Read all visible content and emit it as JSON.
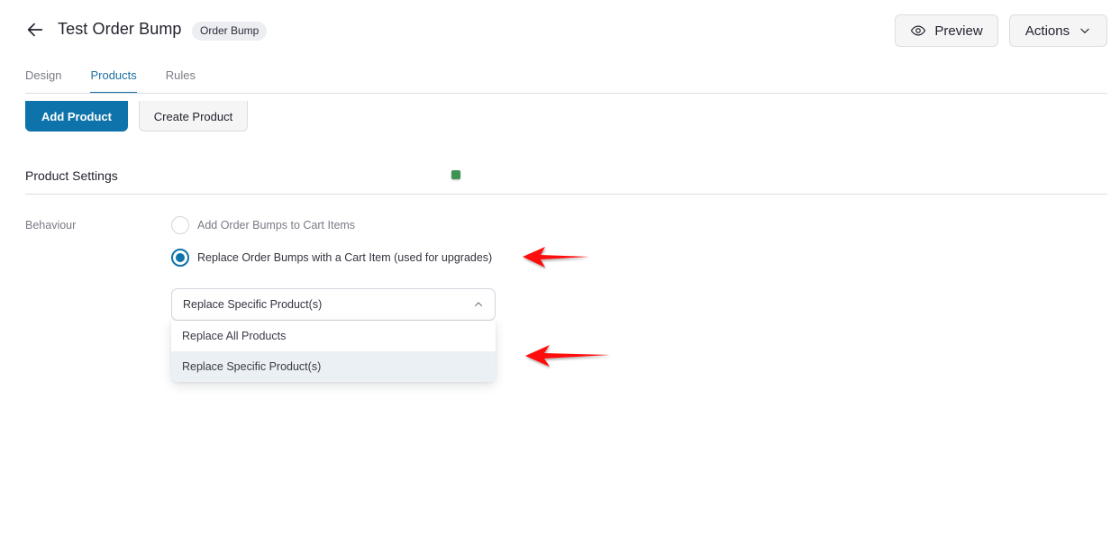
{
  "header": {
    "back_icon": "arrow-left-icon",
    "title": "Test Order Bump",
    "badge": "Order Bump",
    "preview_label": "Preview",
    "preview_icon": "eye-icon",
    "actions_label": "Actions",
    "actions_icon": "chevron-down-icon"
  },
  "tabs": [
    {
      "label": "Design",
      "active": false
    },
    {
      "label": "Products",
      "active": true
    },
    {
      "label": "Rules",
      "active": false
    }
  ],
  "product_buttons": {
    "add_label": "Add Product",
    "create_label": "Create Product"
  },
  "product_settings": {
    "title": "Product Settings",
    "behaviour_label": "Behaviour",
    "options": [
      {
        "label": "Add Order Bumps to Cart Items",
        "checked": false
      },
      {
        "label": "Replace Order Bumps with a Cart Item (used for upgrades)",
        "checked": true
      }
    ],
    "replace_select": {
      "value": "Replace Specific Product(s)",
      "expanded": true,
      "icon": "chevron-up-icon",
      "options": [
        {
          "label": "Replace All Products",
          "selected": false
        },
        {
          "label": "Replace Specific Product(s)",
          "selected": true
        }
      ]
    }
  },
  "annotations": {
    "arrow_color": "#ff0000",
    "arrows": [
      "points-to-replace-radio",
      "points-to-dropdown-options"
    ]
  },
  "colors": {
    "accent": "#0d73aa",
    "status_dot": "#3f9455"
  }
}
